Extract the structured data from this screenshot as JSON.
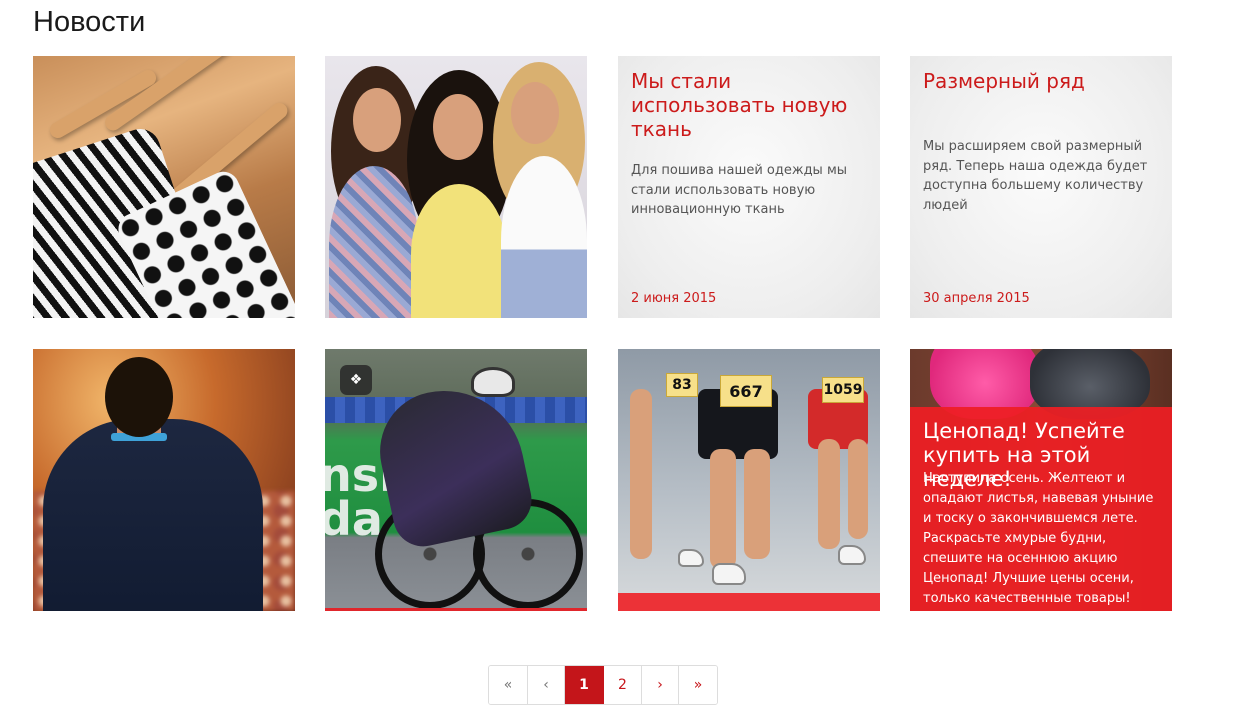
{
  "page": {
    "title": "Новости"
  },
  "news": [
    {
      "type": "photo",
      "image": "clothes-on-hangers"
    },
    {
      "type": "photo",
      "image": "three-women"
    },
    {
      "type": "text",
      "title": "Мы стали использовать новую ткань",
      "body": "Для пошива нашей одежды мы стали использовать новую инновационную ткань",
      "date": "2 июня 2015"
    },
    {
      "type": "text",
      "title": "Размерный ряд",
      "body": "Мы расширяем свой размерный ряд. Теперь наша одежда будет доступна большему количеству людей",
      "date": "30 апреля 2015"
    },
    {
      "type": "photo",
      "image": "speaker-conference"
    },
    {
      "type": "photo",
      "image": "cyclist",
      "badge_icon": "brain-icon"
    },
    {
      "type": "photo",
      "image": "marathon-runners",
      "bibs": [
        "83",
        "667",
        "1059"
      ]
    },
    {
      "type": "promo",
      "image": "pink-sneakers",
      "title": "Ценопад! Успейте купить на этой неделе!",
      "body": "Наступила осень. Желтеют и опадают листья, навевая уныние и тоску о закончившемся лете. Раскрасьте хмурые будни, спешите на осеннюю акцию Ценопад! Лучшие цены осени, только качественные товары!"
    }
  ],
  "pagination": {
    "first": "«",
    "prev": "‹",
    "pages": [
      "1",
      "2"
    ],
    "active": "1",
    "next": "›",
    "last": "»"
  },
  "colors": {
    "accent": "#cc1b1b",
    "promo_bg": "#ee1e24",
    "pagination_active": "#c4151a"
  }
}
